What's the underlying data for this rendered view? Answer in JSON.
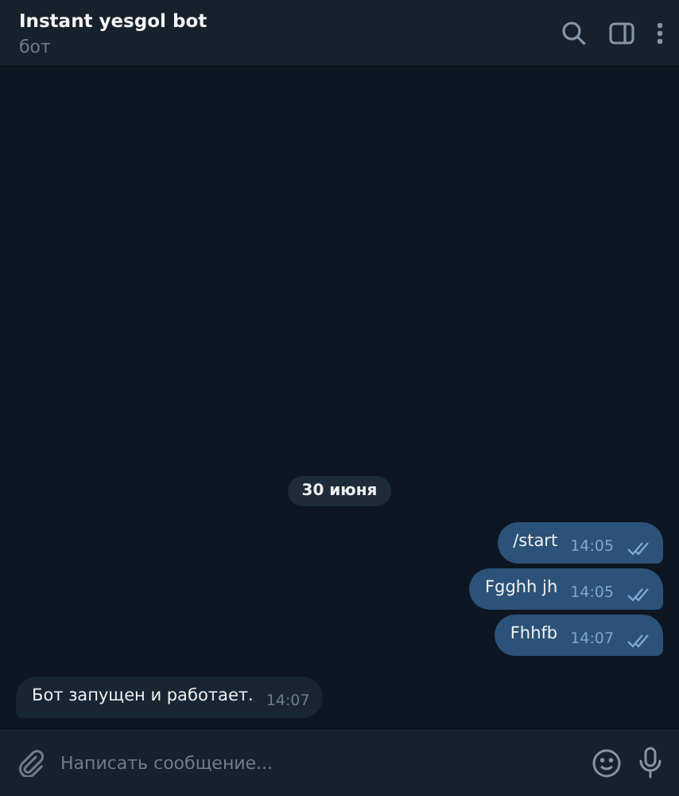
{
  "header": {
    "title": "Instant yesgol bot",
    "subtitle": "бот"
  },
  "date_label": "30 июня",
  "messages": [
    {
      "kind": "outgoing",
      "text": "/start",
      "time": "14:05",
      "read": true
    },
    {
      "kind": "outgoing",
      "text": "Fgghh jh",
      "time": "14:05",
      "read": true
    },
    {
      "kind": "outgoing",
      "text": "Fhhfb",
      "time": "14:07",
      "read": true
    },
    {
      "kind": "incoming",
      "text": "Бот запущен и работает.",
      "time": "14:07"
    }
  ],
  "composer": {
    "placeholder": "Написать сообщение..."
  }
}
